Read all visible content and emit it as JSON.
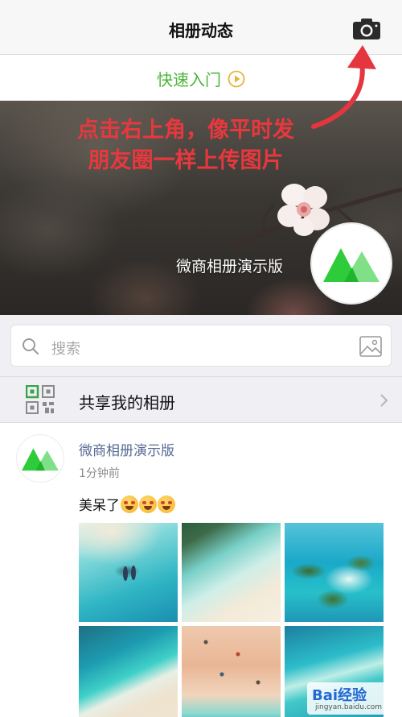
{
  "header": {
    "title": "相册动态",
    "camera_icon": "camera-icon"
  },
  "quick_entry": {
    "label": "快速入门",
    "icon": "play-circle-icon",
    "color": "#4bb53a"
  },
  "banner": {
    "overlay_lines": [
      "点击右上角，像平时发",
      "朋友圈一样上传图片"
    ],
    "overlay_color": "#e8383d",
    "album_name": "微商相册演示版",
    "logo_icon": "green-mountain-logo"
  },
  "search": {
    "placeholder": "搜索",
    "image_search_icon": "image-icon"
  },
  "share": {
    "label": "共享我的相册",
    "icon": "qr-code-icon"
  },
  "post": {
    "author": "微商相册演示版",
    "time": "1分钟前",
    "text": "美呆了",
    "emoji_count": 3,
    "photos": [
      "photo-1",
      "photo-2",
      "photo-3",
      "photo-4",
      "photo-5",
      "photo-6"
    ]
  },
  "watermark": {
    "text": "Bai经验",
    "sub": "jingyan.baidu.com"
  }
}
